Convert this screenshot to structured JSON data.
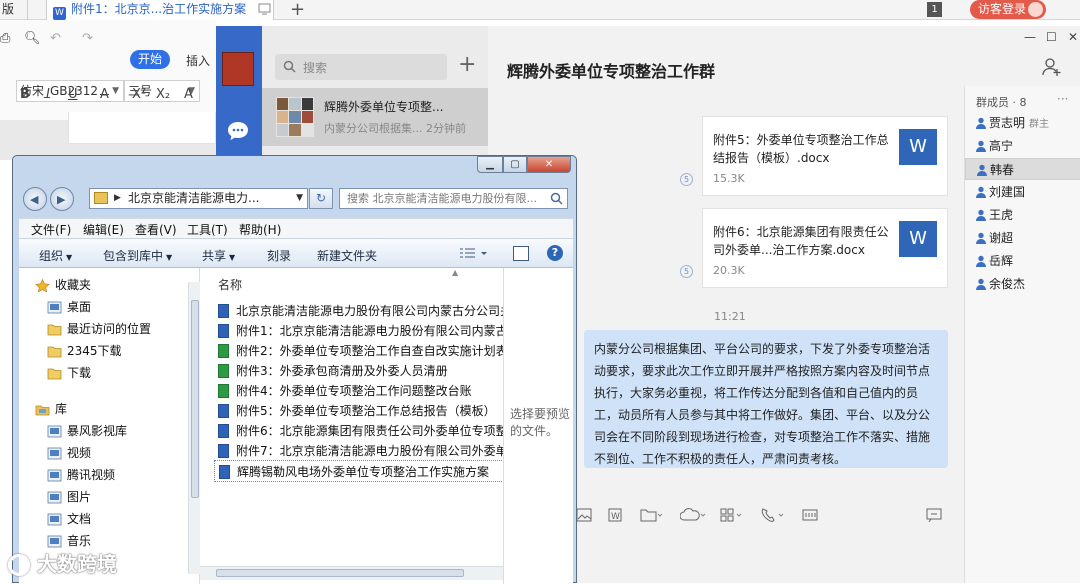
{
  "wps": {
    "prev_tab": "版",
    "doc_tab": "附件1：北京京...治工作实施方案",
    "doc_icon": "W",
    "count_badge": "1",
    "login": "访客登录",
    "start": "开始",
    "insert": "插入",
    "font": "仿宋_GB2312",
    "size": "三号"
  },
  "chat": {
    "search_placeholder": "搜索",
    "conversation": {
      "title": "辉腾外委单位专项整...",
      "preview": "内蒙分公司根据集... 2分钟前"
    },
    "title": "辉腾外委单位专项整治工作群",
    "files": [
      {
        "name": "附件5：外委单位专项整治工作总结报告（模板）.docx",
        "size": "15.3K",
        "icon": "W"
      },
      {
        "name": "附件6：北京能源集团有限责任公司外委单...治工作方案.docx",
        "size": "20.3K",
        "icon": "W"
      }
    ],
    "read_mark": "5",
    "time": "11:21",
    "message": "内蒙分公司根据集团、平台公司的要求，下发了外委专项整治活动要求，要求此次工作立即开展并严格按照方案内容及时间节点执行，大家务必重视，将工作传达分配到各值和自己值内的员工，动员所有人员参与其中将工作做好。集团、平台、以及分公司会在不同阶段到现场进行检查，对专项整治工作不落实、措施不到位、工作不积极的责任人，严肃问责考核。",
    "members_title": "群成员 · 8",
    "members": [
      {
        "name": "贾志明",
        "role": "群主"
      },
      {
        "name": "高宁",
        "role": ""
      },
      {
        "name": "韩春",
        "role": ""
      },
      {
        "name": "刘建国",
        "role": ""
      },
      {
        "name": "王虎",
        "role": ""
      },
      {
        "name": "谢超",
        "role": ""
      },
      {
        "name": "岳辉",
        "role": ""
      },
      {
        "name": "余俊杰",
        "role": ""
      }
    ]
  },
  "explorer": {
    "address": "北京京能清洁能源电力...",
    "search_placeholder": "搜索 北京京能清洁能源电力股份有限...",
    "menu": [
      "文件(F)",
      "编辑(E)",
      "查看(V)",
      "工具(T)",
      "帮助(H)"
    ],
    "commands": [
      "组织",
      "包含到库中",
      "共享",
      "刻录",
      "新建文件夹"
    ],
    "nav": [
      {
        "label": "收藏夹",
        "group": true
      },
      {
        "label": "桌面",
        "group": false
      },
      {
        "label": "最近访问的位置",
        "group": false
      },
      {
        "label": "2345下载",
        "group": false
      },
      {
        "label": "下载",
        "group": false
      },
      {
        "label": "库",
        "group": true
      },
      {
        "label": "暴风影视库",
        "group": false
      },
      {
        "label": "视频",
        "group": false
      },
      {
        "label": "腾讯视频",
        "group": false
      },
      {
        "label": "图片",
        "group": false
      },
      {
        "label": "文档",
        "group": false
      },
      {
        "label": "音乐",
        "group": false
      }
    ],
    "column_name": "名称",
    "files": [
      {
        "name": "北京京能清洁能源电力股份有限公司内蒙古分公司关于...",
        "type": "w"
      },
      {
        "name": "附件1：北京京能清洁能源电力股份有限公司内蒙古分...",
        "type": "w"
      },
      {
        "name": "附件2：外委单位专项整治工作自查自改实施计划表",
        "type": "x"
      },
      {
        "name": "附件3：外委承包商清册及外委人员清册",
        "type": "x"
      },
      {
        "name": "附件4：外委单位专项整治工作问题整改台账",
        "type": "x"
      },
      {
        "name": "附件5：外委单位专项整治工作总结报告（模板）",
        "type": "w"
      },
      {
        "name": "附件6：北京能源集团有限责任公司外委单位专项整治...",
        "type": "w"
      },
      {
        "name": "附件7：北京京能清洁能源电力股份有限公司外委单位...",
        "type": "w"
      },
      {
        "name": "辉腾锡勒风电场外委单位专项整治工作实施方案",
        "type": "w"
      }
    ],
    "preview_text": "选择要预览的文件。"
  },
  "watermark": "大数跨境"
}
